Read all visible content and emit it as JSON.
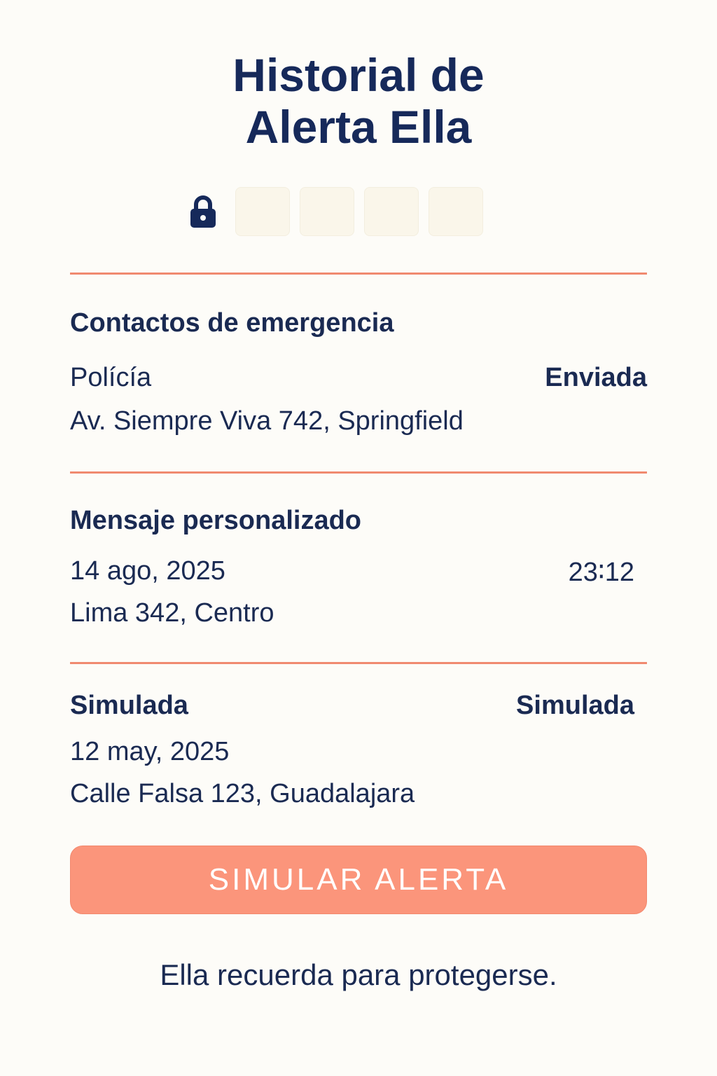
{
  "header": {
    "title_line1": "Historial de",
    "title_line2": "Alerta Ella"
  },
  "pin": {
    "icon": "lock-icon",
    "digits": [
      "",
      "",
      "",
      ""
    ]
  },
  "sections": [
    {
      "title": "Contactos de emergencia",
      "line1": "Polícía",
      "line2": "Av. Siempre Viva 742, Springfield",
      "status": "Enviada"
    },
    {
      "title": "Mensaje personalizado",
      "line1": "14 ago, 2025",
      "line2": "Lima 342, Centro",
      "time": "23∶12"
    },
    {
      "title": "Simulada",
      "line1": "12 may, 2025",
      "line2": "Calle Falsa 123, Guadalajara",
      "status": "Simulada"
    }
  ],
  "actions": {
    "simulate_label": "SIMULAR ALERTA"
  },
  "footer": {
    "tagline": "Ella recuerda para protegerse."
  },
  "colors": {
    "accent": "#f08a70",
    "button": "#fb957b",
    "text": "#1a2a52",
    "background": "#fdfcf8"
  }
}
